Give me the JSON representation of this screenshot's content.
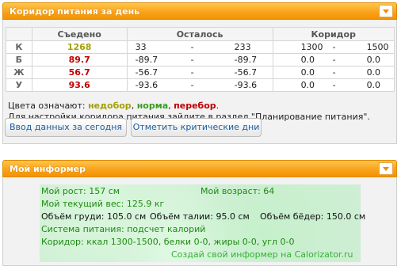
{
  "panel1": {
    "title": "Коридор питания за день",
    "headers": {
      "eaten": "Съедено",
      "remaining": "Осталось",
      "corridor": "Коридор"
    },
    "rows": [
      {
        "label": "К",
        "eaten": "1268",
        "eaten_color": "#a5a000",
        "rem_a": "33",
        "rem_dash": "-",
        "rem_b": "233",
        "corr_a": "1300",
        "corr_dash": "-",
        "corr_b": "1500"
      },
      {
        "label": "Б",
        "eaten": "89.7",
        "eaten_color": "#c00000",
        "rem_a": "-89.7",
        "rem_dash": "-",
        "rem_b": "-89.7",
        "corr_a": "0.0",
        "corr_dash": "-",
        "corr_b": "0.0"
      },
      {
        "label": "Ж",
        "eaten": "56.7",
        "eaten_color": "#c00000",
        "rem_a": "-56.7",
        "rem_dash": "-",
        "rem_b": "-56.7",
        "corr_a": "0.0",
        "corr_dash": "-",
        "corr_b": "0.0"
      },
      {
        "label": "У",
        "eaten": "93.6",
        "eaten_color": "#c00000",
        "rem_a": "-93.6",
        "rem_dash": "-",
        "rem_b": "-93.6",
        "corr_a": "0.0",
        "corr_dash": "-",
        "corr_b": "0.0"
      }
    ],
    "legend": {
      "prefix": "Цвета означают:",
      "lack": "недобор",
      "sep1": ",",
      "norm": "норма",
      "sep2": ",",
      "over": "перебор",
      "end": "."
    },
    "hint": "Для настройки коридора питания зайдите в раздел \"Планирование питания\".",
    "button_today": "Ввод данных за сегодня",
    "button_critical": "Отметить критические дни"
  },
  "panel2": {
    "title": "Мой информер",
    "height": "Мой рост: 157 см",
    "age": "Мой возраст: 64",
    "weight": "Мой текущий вес: 125.9 кг",
    "chest": "Объём груди: 105.0 см",
    "waist": "Объём талии: 95.0 см",
    "hips": "Объём бёдер: 150.0 см",
    "system": "Система питания: подсчет калорий",
    "corridor": "Коридор: ккал 1300-1500, белки 0-0, жиры 0-0, угл 0-0",
    "link": "Создай свой информер на Calorizator.ru"
  },
  "colors": {
    "accent": "#f9a31b",
    "lack": "#a5a000",
    "norm": "#3b9b1f",
    "over": "#c00000"
  }
}
